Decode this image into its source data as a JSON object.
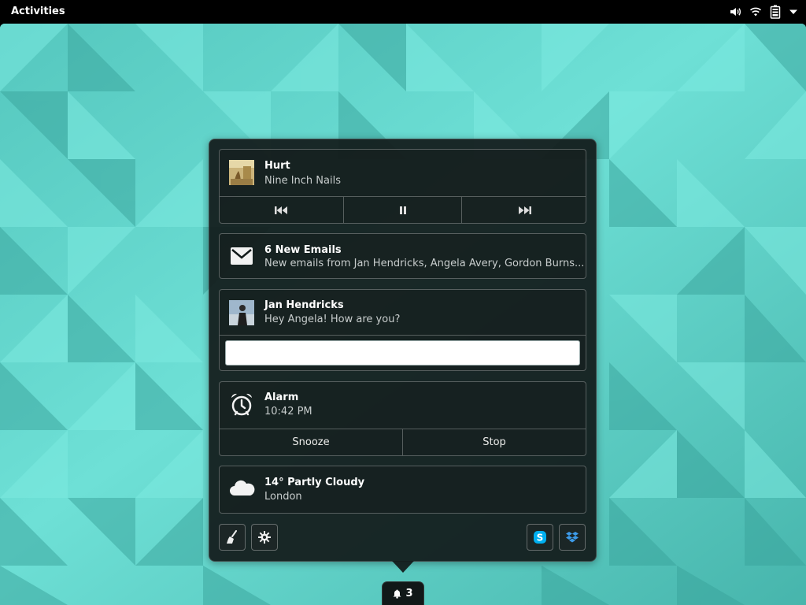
{
  "topbar": {
    "activities_label": "Activities",
    "icons": [
      "volume-icon",
      "wifi-icon",
      "battery-icon",
      "dropdown-arrow-icon"
    ]
  },
  "notifications": {
    "media": {
      "title": "Hurt",
      "artist": "Nine Inch Nails",
      "controls": [
        "previous-track-icon",
        "pause-icon",
        "next-track-icon"
      ]
    },
    "email": {
      "icon": "mail-icon",
      "title": "6 New Emails",
      "body": "New emails from Jan Hendricks, Angela Avery, Gordon Burns..."
    },
    "chat": {
      "title": "Jan Hendricks",
      "body": "Hey Angela! How are you?",
      "reply_value": ""
    },
    "alarm": {
      "icon": "alarm-clock-icon",
      "title": "Alarm",
      "time": "10:42 PM",
      "snooze_label": "Snooze",
      "stop_label": "Stop"
    },
    "weather": {
      "icon": "cloud-icon",
      "title": "14° Partly Cloudy",
      "location": "London"
    }
  },
  "tray_footer": {
    "left": [
      "clear-broom-icon",
      "settings-gear-icon"
    ],
    "right": [
      "skype-icon",
      "dropbox-icon"
    ]
  },
  "indicator": {
    "icon": "bell-icon",
    "count": "3"
  },
  "colors": {
    "wallpaper": "#5ecfc6",
    "panel": "#000000",
    "tray_bg": "#121a1a",
    "skype": "#00aff0",
    "dropbox": "#1f7ee0"
  }
}
